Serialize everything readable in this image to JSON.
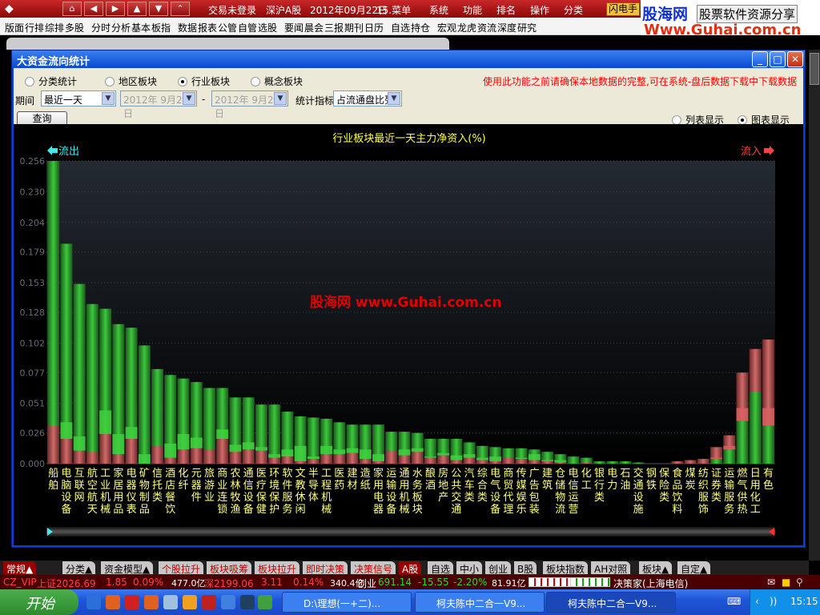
{
  "topbar": {
    "status": "交易未登录",
    "market": "深沪A股",
    "date": "2012年09月22日",
    "menu": "15.菜单",
    "items": [
      "系统",
      "功能",
      "排名",
      "操作",
      "分类"
    ],
    "flash": "闪电手"
  },
  "ad": {
    "brand": "股海网",
    "slogan": "股票软件资源分享",
    "url": "Www.Guhai.com.cn"
  },
  "menubar": [
    "版面",
    "行排",
    "综排",
    "多股",
    "分时",
    "分析",
    "基本",
    "板指",
    "数据",
    "报表",
    "公管",
    "自管",
    "选股",
    "要闻",
    "晨会",
    "三报",
    "期刊",
    "日历",
    "自选",
    "持仓",
    "宏观",
    "龙虎",
    "资流",
    "深度",
    "研究"
  ],
  "dialog": {
    "title": "大资金流向统计",
    "scope_options": [
      {
        "label": "分类统计",
        "checked": false
      },
      {
        "label": "地区板块",
        "checked": false
      },
      {
        "label": "行业板块",
        "checked": true
      },
      {
        "label": "概念板块",
        "checked": false
      }
    ],
    "warning": "使用此功能之前请确保本地数据的完整,可在系统-盘后数据下载中下载数据",
    "period_label": "期间",
    "period_value": "最近一天",
    "date_from": "2012年 9月21日",
    "date_sep": "-",
    "date_to": "2012年 9月21日",
    "metric_label": "统计指标",
    "metric_value": "占流通盘比列",
    "query_button": "查询",
    "display_options": [
      {
        "label": "列表显示",
        "checked": false
      },
      {
        "label": "图表显示",
        "checked": true
      }
    ]
  },
  "chart_data": {
    "type": "bar",
    "title": "行业板块最近一天主力净资入(%)",
    "left_label": "流出",
    "right_label": "流入",
    "watermark": "股海网  www.Guhai.com.cn",
    "yticks": [
      "0.000",
      "0.026",
      "0.051",
      "0.077",
      "0.102",
      "0.128",
      "0.153",
      "0.179",
      "0.204",
      "0.230",
      "0.256"
    ],
    "ylim": [
      0,
      0.256
    ],
    "grid": true,
    "colors": {
      "out": "#30b030",
      "in": "#c05050"
    },
    "categories": [
      "船舶",
      "电脑设备",
      "互联网",
      "航空航天",
      "工业机械",
      "家居用品",
      "电器仪表",
      "矿物制品",
      "信托类",
      "酒店餐饮",
      "化纤",
      "元器件",
      "旅游业",
      "商业连锁",
      "农林牧渔",
      "通信设备",
      "医疗保健",
      "环境保护",
      "软件服务",
      "文教休闲",
      "半导体",
      "工程机械",
      "医药",
      "建材",
      "造纸",
      "家用电器",
      "运输设备",
      "通用机械",
      "水务板块",
      "酿酒",
      "房地产",
      "公共交通",
      "汽车类",
      "综合类",
      "电气设备",
      "商贸代理",
      "传媒娱乐",
      "广告包装",
      "建筑",
      "仓储物流",
      "电信运营",
      "化工",
      "银行类",
      "电力",
      "石油",
      "交通设施",
      "钢铁",
      "保险类",
      "食品饮料",
      "煤炭",
      "纺织服饰",
      "证券类",
      "运输服务",
      "燃气供热",
      "日用化工",
      "有色"
    ],
    "values": [
      0.256,
      0.186,
      0.152,
      0.135,
      0.131,
      0.118,
      0.115,
      0.1,
      0.08,
      0.075,
      0.072,
      0.069,
      0.064,
      0.064,
      0.056,
      0.056,
      0.05,
      0.05,
      0.044,
      0.04,
      0.039,
      0.038,
      0.035,
      0.033,
      0.033,
      0.033,
      0.027,
      0.027,
      0.026,
      0.021,
      0.021,
      0.021,
      0.018,
      0.015,
      0.014,
      0.013,
      0.013,
      0.012,
      0.01,
      0.008,
      0.006,
      0.005,
      0.002,
      0.002,
      0.002,
      0.001,
      0,
      0,
      0.002,
      0.003,
      0.004,
      0.014,
      0.024,
      0.077,
      0.097,
      0.105
    ],
    "direction": [
      "out",
      "out",
      "out",
      "out",
      "out",
      "out",
      "out",
      "out",
      "out",
      "out",
      "out",
      "out",
      "out",
      "out",
      "out",
      "out",
      "out",
      "out",
      "out",
      "out",
      "out",
      "out",
      "out",
      "out",
      "out",
      "out",
      "out",
      "out",
      "out",
      "out",
      "out",
      "out",
      "out",
      "out",
      "out",
      "out",
      "out",
      "out",
      "out",
      "out",
      "out",
      "out",
      "out",
      "out",
      "out",
      "out",
      "out",
      "out",
      "in",
      "in",
      "in",
      "in",
      "in",
      "in",
      "in",
      "in"
    ],
    "base_values": [
      0.032,
      0.021,
      0.011,
      0.01,
      0.025,
      0.008,
      0.021,
      0,
      0.015,
      0.005,
      0.012,
      0.013,
      0.012,
      0.021,
      0.01,
      0.012,
      0.011,
      0.005,
      0.006,
      0.002,
      0.004,
      0.008,
      0.008,
      0.009,
      0.004,
      0.002,
      0.011,
      0.007,
      0.01,
      0.005,
      0.007,
      0.003,
      0.005,
      0.003,
      0.002,
      0.005,
      0.004,
      0.003,
      0.002,
      0.001,
      0,
      0.001,
      0,
      0,
      0,
      0,
      0,
      0,
      0,
      0,
      0,
      0.004,
      0.012,
      0.036,
      0.061,
      0.032
    ],
    "band_values": [
      0.032,
      0.035,
      0.023,
      0.01,
      0.045,
      0.025,
      0.031,
      0.008,
      0.015,
      0.017,
      0.025,
      0.022,
      0.012,
      0.029,
      0.016,
      0.018,
      0.014,
      0.008,
      0.012,
      0.015,
      0.006,
      0.015,
      0.012,
      0.013,
      0.012,
      0.008,
      0.011,
      0.012,
      0.013,
      0.006,
      0.009,
      0.007,
      0.008,
      0.005,
      0.006,
      0.005,
      0.005,
      0.008,
      0.003,
      0.003,
      0,
      0.001,
      0,
      0,
      0,
      0,
      0,
      0,
      0,
      0,
      0,
      0.005,
      0.015,
      0.047,
      0.061,
      0.047
    ]
  },
  "bottom_tabs": [
    "常规▲",
    "分类▲",
    "资金模型▲",
    "个股拉升",
    "板块吸筹",
    "板块拉升",
    "即时决策",
    "决策信号",
    "A股",
    "自选",
    "中小",
    "创业",
    "B股",
    "板块指数",
    "AH对照",
    "板块▲",
    "自定▲"
  ],
  "status": {
    "user": "CZ_VIP",
    "sh": "上证2026.69",
    "sh_chg": "1.85",
    "sh_pct": "0.09%",
    "sh_amt": "477.0亿",
    "sz": "深2199.06",
    "sz_chg": "3.11",
    "sz_pct": "0.14%",
    "sz_amt": "340.4亿",
    "cy": "创业",
    "cy_val": "691.14",
    "cy_chg": "-15.55",
    "cy_pct": "-2.20%",
    "cy_amt": "81.91亿",
    "broker": "决策家(上海电信)"
  },
  "taskbar": {
    "start": "开始",
    "tasks": [
      "D:\\理想(一+二)...",
      "柯夫陈中二合一V9...",
      "柯夫陈中二合一V9..."
    ],
    "clock": "15:15"
  }
}
